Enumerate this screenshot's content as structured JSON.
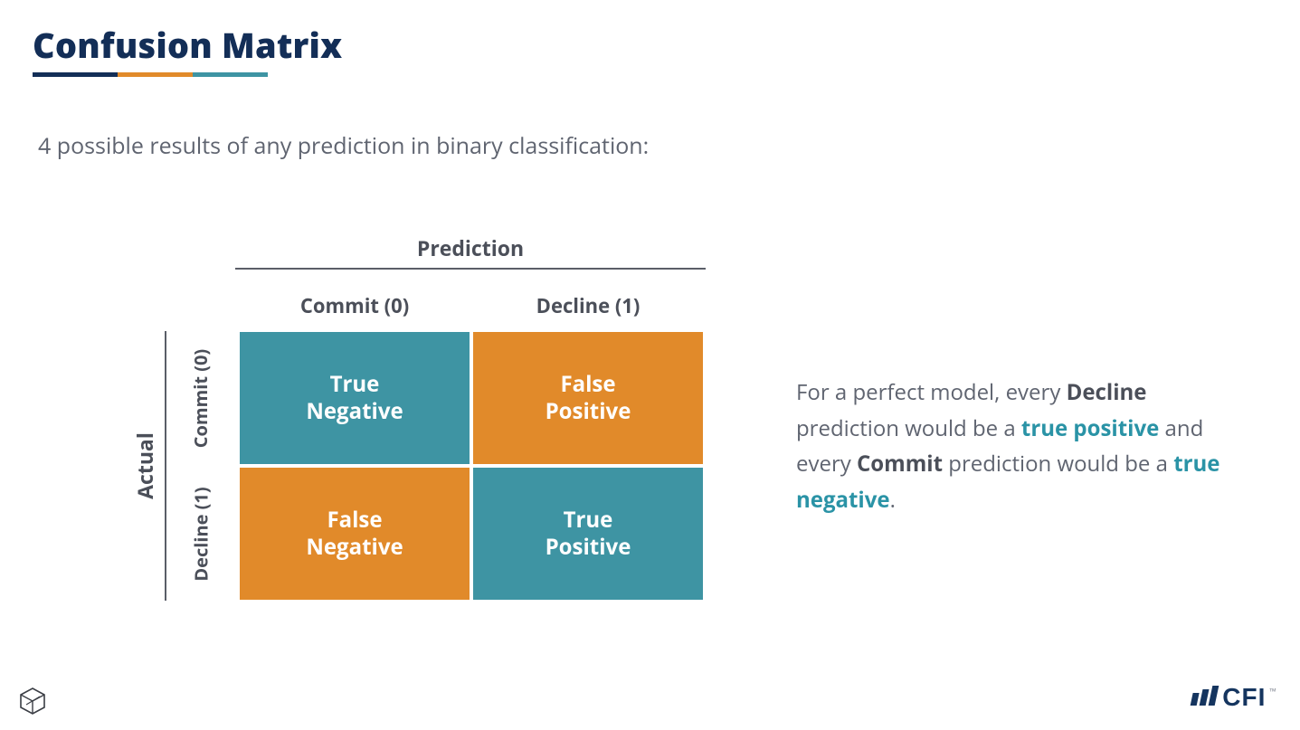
{
  "title": "Confusion Matrix",
  "subtitle": "4 possible results of any prediction in binary classification:",
  "matrix": {
    "axis_top": "Prediction",
    "axis_left": "Actual",
    "col_headers": [
      "Commit (0)",
      "Decline (1)"
    ],
    "row_headers": [
      "Commit (0)",
      "Decline (1)"
    ],
    "cells": {
      "tn": {
        "line1": "True",
        "line2": "Negative"
      },
      "fp": {
        "line1": "False",
        "line2": "Positive"
      },
      "fn": {
        "line1": "False",
        "line2": "Negative"
      },
      "tp": {
        "line1": "True",
        "line2": "Positive"
      }
    },
    "colors": {
      "teal": "#3e94a3",
      "orange": "#e18a2a"
    }
  },
  "explanation": {
    "t1": "For a perfect model, every ",
    "decline": "Decline",
    "t2": " prediction would be a ",
    "true_positive": "true positive",
    "t3": " and every ",
    "commit": "Commit",
    "t4": " prediction would be a ",
    "true_negative": "true negative",
    "t5": "."
  },
  "footer": {
    "brand": "CFI",
    "tm": "™"
  },
  "chart_data": {
    "type": "table",
    "title": "Confusion Matrix",
    "row_axis": "Actual",
    "col_axis": "Prediction",
    "row_labels": [
      "Commit (0)",
      "Decline (1)"
    ],
    "col_labels": [
      "Commit (0)",
      "Decline (1)"
    ],
    "values": [
      [
        "True Negative",
        "False Positive"
      ],
      [
        "False Negative",
        "True Positive"
      ]
    ],
    "cell_colors": [
      [
        "#3e94a3",
        "#e18a2a"
      ],
      [
        "#e18a2a",
        "#3e94a3"
      ]
    ]
  }
}
